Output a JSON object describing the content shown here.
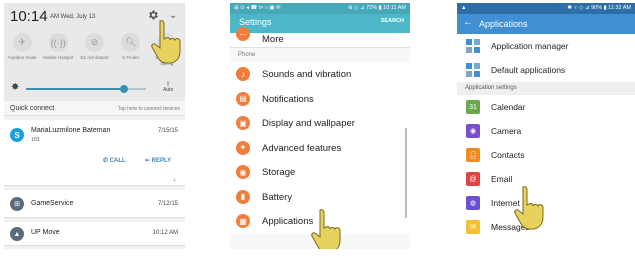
{
  "panel1": {
    "clock": "10:14",
    "date": "AM Wed, July 13",
    "quick_settings": [
      {
        "label": "Airplane mode",
        "icon": "airplane-icon",
        "glyph": "✈"
      },
      {
        "label": "Mobile Hotspot",
        "icon": "hotspot-icon",
        "glyph": "((·))"
      },
      {
        "label": "Do not disturb",
        "icon": "do-not-disturb-icon",
        "glyph": "⊘"
      },
      {
        "label": "S Finder",
        "icon": "search-icon",
        "glyph": "🔍︎"
      },
      {
        "label": "Ultra power saving",
        "icon": "power-saving-icon",
        "glyph": "◐"
      }
    ],
    "brightness": {
      "level": 0.82,
      "auto_label": "Auto"
    },
    "quick_connect": {
      "title": "Quick connect",
      "hint": "Tap here to connect devices"
    },
    "notifications": {
      "skype": {
        "title": "MariaLuzmilone Bateman",
        "sub": "103",
        "time": "7/15/15",
        "call": "CALL",
        "reply": "REPLY"
      },
      "game": {
        "title": "GameService",
        "time": "7/12/15"
      },
      "up": {
        "title": "UP Move",
        "time": "10:12 AM"
      }
    }
  },
  "panel2": {
    "status_left": "⊞ ⊙ ◂ ☎ ⊳ ♭ ▣ ✉",
    "status_right": "⊛ ◇ ⊿ 72% ▮ 10:11 AM",
    "title": "Settings",
    "search": "SEARCH",
    "more": "More",
    "section": "Phone",
    "items": [
      {
        "label": "Sounds and vibration",
        "glyph": "♪"
      },
      {
        "label": "Notifications",
        "glyph": "▤"
      },
      {
        "label": "Display and wallpaper",
        "glyph": "▣"
      },
      {
        "label": "Advanced features",
        "glyph": "✦"
      },
      {
        "label": "Storage",
        "glyph": "◉"
      },
      {
        "label": "Battery",
        "glyph": "▮"
      },
      {
        "label": "Applications",
        "glyph": "▦"
      }
    ]
  },
  "panel3": {
    "status_left": "▲",
    "status_right": "✱ ♆ ◇ ⊿ 90% ▮ 11:32 AM",
    "title": "Applications",
    "back": "←",
    "top_items": [
      {
        "label": "Application manager",
        "icon": "app-manager-icon"
      },
      {
        "label": "Default applications",
        "icon": "default-apps-icon"
      }
    ],
    "section": "Application settings",
    "app_items": [
      {
        "label": "Calendar",
        "icon": "calendar-icon",
        "glyph": "31"
      },
      {
        "label": "Camera",
        "icon": "camera-icon",
        "glyph": "◉"
      },
      {
        "label": "Contacts",
        "icon": "contacts-icon",
        "glyph": "👤︎"
      },
      {
        "label": "Email",
        "icon": "email-icon",
        "glyph": "@"
      },
      {
        "label": "Internet",
        "icon": "internet-icon",
        "glyph": "◍"
      },
      {
        "label": "Messages",
        "icon": "messages-icon",
        "glyph": "✉"
      }
    ]
  },
  "colors": {
    "settings_teal": "#4db6c7",
    "settings_orange": "#ef7d3b",
    "apps_blue": "#3f8fd2",
    "hand": "#e8d25f"
  }
}
